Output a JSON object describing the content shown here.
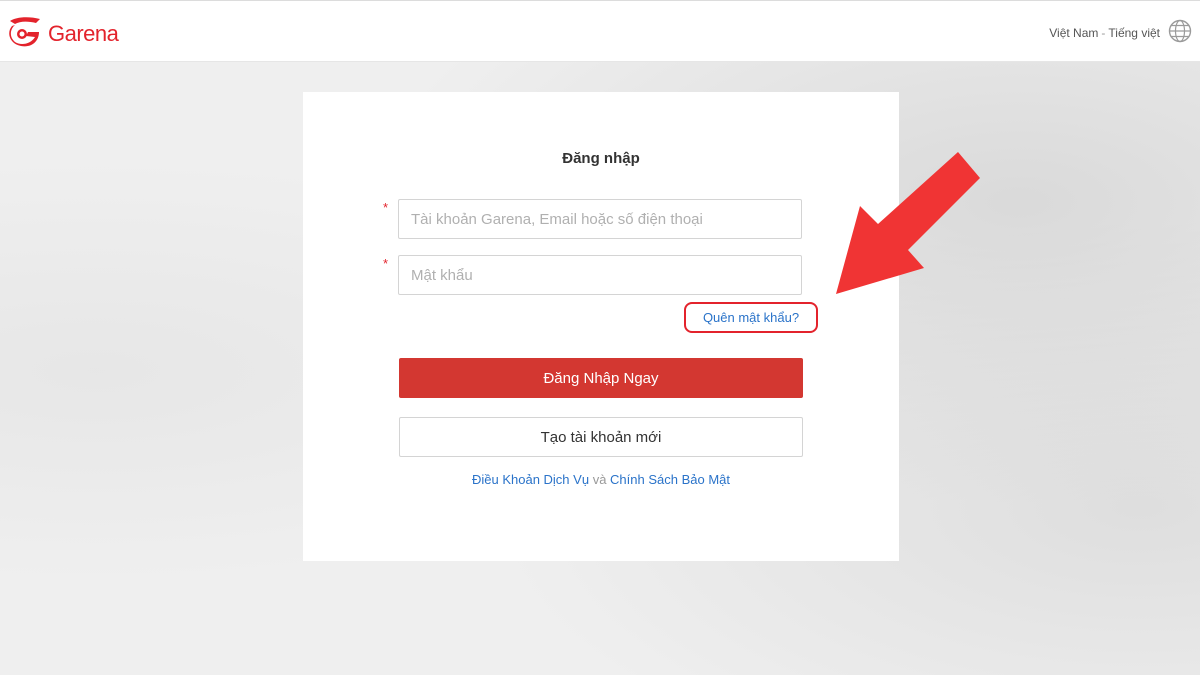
{
  "header": {
    "brand": "Garena",
    "region": "Việt Nam",
    "separator": "-",
    "language": "Tiếng việt",
    "icons": {
      "logo": "garena-logo-icon",
      "language": "globe-icon"
    }
  },
  "login": {
    "title": "Đăng nhập",
    "required_mark": "*",
    "account_placeholder": "Tài khoản Garena, Email hoặc số điện thoại",
    "account_value": "",
    "password_placeholder": "Mật khẩu",
    "password_value": "",
    "forgot_password": "Quên mật khẩu?",
    "login_button": "Đăng Nhập Ngay",
    "create_account_button": "Tạo tài khoản mới",
    "terms_link": "Điều Khoản Dịch Vụ",
    "and_text": "và",
    "privacy_link": "Chính Sách Bảo Mật"
  },
  "colors": {
    "brand": "#e3232c",
    "primary_button": "#d33731",
    "link": "#2a73c9",
    "annotation": "#f03434"
  }
}
